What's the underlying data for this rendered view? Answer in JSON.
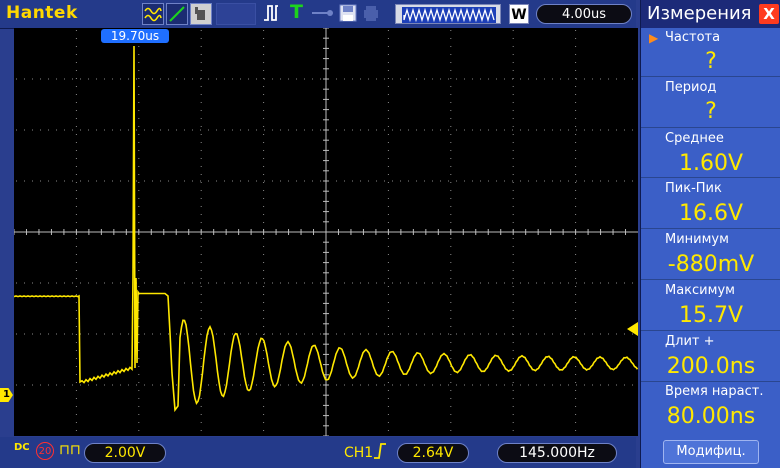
{
  "toolbar": {
    "brand": "Hantek",
    "w_label": "W",
    "timebase": "4.00us",
    "trigger_t": "T"
  },
  "cursor": {
    "label": "19.70us"
  },
  "channel": {
    "marker": "1",
    "volts_per_div": "2.00V",
    "bandwidth_limit": "20",
    "coupling": "DC"
  },
  "trigger": {
    "source": "CH1",
    "level": "2.64V",
    "frequency": "145.000Hz"
  },
  "panel": {
    "title": "Измерения",
    "close": "X",
    "modify_button": "Модифиц.",
    "items": [
      {
        "label": "Частота",
        "value": "?"
      },
      {
        "label": "Период",
        "value": "?"
      },
      {
        "label": "Среднее",
        "value": "1.60V"
      },
      {
        "label": "Пик-Пик",
        "value": "16.6V"
      },
      {
        "label": "Минимум",
        "value": "-880mV"
      },
      {
        "label": "Максимум",
        "value": "15.7V"
      },
      {
        "label": "Длит +",
        "value": "200.0ns"
      },
      {
        "label": "Время нараст.",
        "value": "80.00ns"
      }
    ]
  },
  "colors": {
    "trace": "#ffe800",
    "grid": "#8a8a8a",
    "panel_bg": "#3b5fc7",
    "value": "#ffe800"
  }
}
